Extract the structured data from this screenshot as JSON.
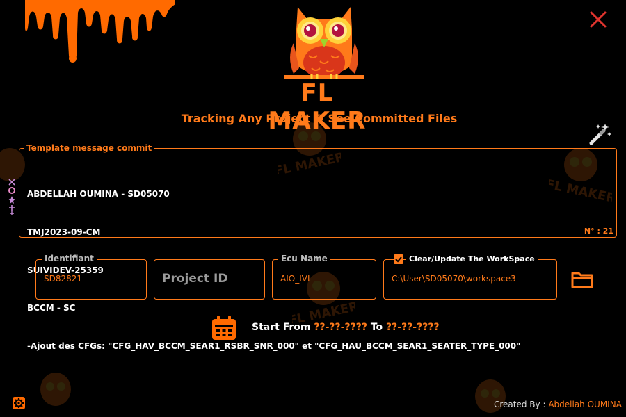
{
  "app": {
    "brand": "FL MAKER",
    "tagline": "Tracking Any Project & See Committed Files",
    "watermark_text": "FL MAKER"
  },
  "template": {
    "label": "Template message commit",
    "lines": [
      "ABDELLAH OUMINA - SD05070",
      "TMJ2023-09-CM",
      "SUIVIDEV-25359",
      "BCCM - SC",
      "-Ajout des CFGs: \"CFG_HAV_BCCM_SEAR1_RSBR_SNR_000\" et \"CFG_HAU_BCCM_SEAR1_SEATER_TYPE_000\""
    ],
    "counter": "N° : 21"
  },
  "fields": {
    "identifiant": {
      "label": "Identifiant",
      "value": "SD82821"
    },
    "project_id": {
      "placeholder": "Project ID"
    },
    "ecu_name": {
      "label": "Ecu Name",
      "value": "AIO_IVI"
    },
    "workspace": {
      "checkbox_label": "Clear/Update The WorkSpace",
      "checked": true,
      "value": "C:\\User\\SD05070\\workspace3"
    }
  },
  "date_range": {
    "prefix": "Start From",
    "start": "??-??-????",
    "middle": "To",
    "end": "??-??-????"
  },
  "footer": {
    "created_by_label": "Created By :",
    "author": "Abdellah OUMINA"
  },
  "icons": {
    "close": "close-icon",
    "wand": "magic-wand-icon",
    "folder": "folder-icon",
    "calendar": "calendar-icon",
    "settings": "gear-icon",
    "logo": "owl-logo-icon"
  },
  "colors": {
    "accent": "#ff7a1a",
    "background": "#000000",
    "close": "#e0342e"
  }
}
